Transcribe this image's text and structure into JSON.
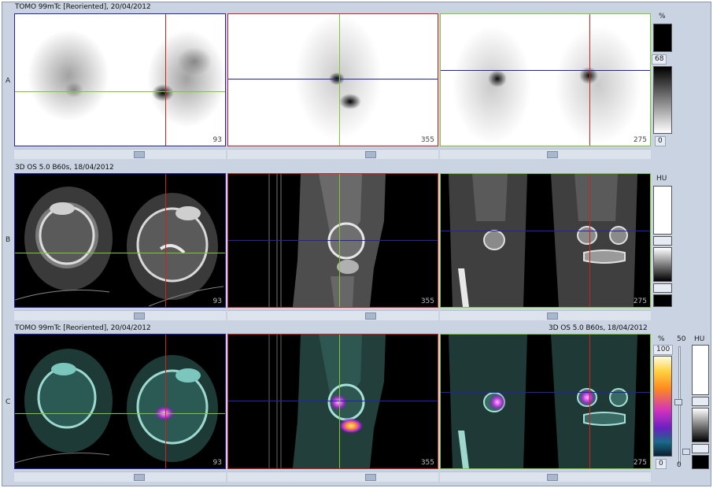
{
  "section_a": {
    "title": "TOMO 99mTc [Reoriented], 20/04/2012",
    "row_label": "A"
  },
  "section_b": {
    "title": "3D  OS  5.0  B60s, 18/04/2012",
    "row_label": "B"
  },
  "section_c": {
    "title_left": "TOMO 99mTc [Reoriented], 20/04/2012",
    "title_right": "3D  OS  5.0  B60s, 18/04/2012",
    "row_label": "C"
  },
  "slices": {
    "transverse": "93",
    "sagittal": "355",
    "coronal": "275"
  },
  "scale_a": {
    "unit": "%",
    "value": "68",
    "min": "0"
  },
  "scale_b": {
    "unit": "HU"
  },
  "scale_c": {
    "unit_pct": "%",
    "max": "100",
    "min": "0",
    "slider_value": "50",
    "unit_hu": "HU",
    "hu_min": "0"
  },
  "colors": {
    "crosshair_red": "#cc2222",
    "crosshair_green": "#7ec832",
    "crosshair_blue": "#2222aa",
    "frame_bg": "#c9d3e2"
  },
  "icons": [
    "crosshair",
    "scroll-thumb",
    "colorbar",
    "slider-knob"
  ]
}
